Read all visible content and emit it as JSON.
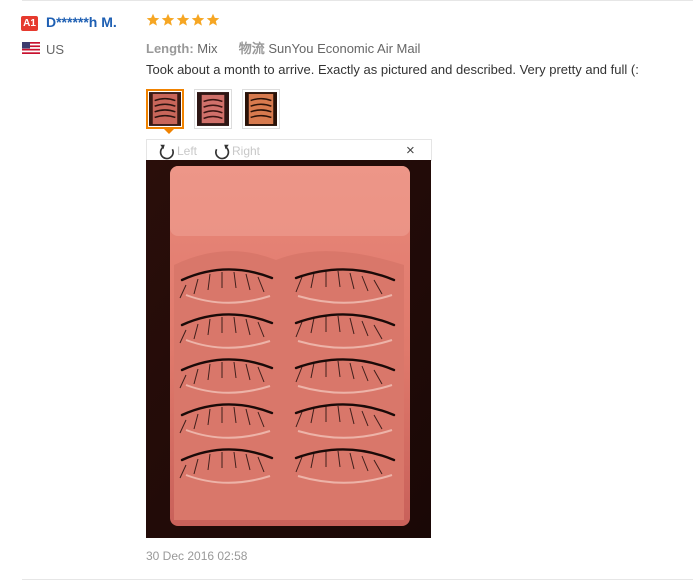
{
  "review": {
    "badge": "A1",
    "user_name": "D******h M.",
    "country": "US",
    "rating": 5,
    "attributes": [
      {
        "key": "Length:",
        "value": "Mix"
      },
      {
        "key": "物流",
        "value": "SunYou Economic Air Mail"
      }
    ],
    "text": "Took about a month to arrive. Exactly as pictured and described. Very pretty and full (:",
    "date": "30 Dec 2016 02:58"
  },
  "viewer": {
    "rotate_left_label": "Left",
    "rotate_right_label": "Right",
    "close_label": "×"
  },
  "colors": {
    "star": "#f6a623",
    "link": "#1e5fb3",
    "badge": "#e63a2e",
    "thumb_active_border": "#f08200"
  },
  "icons": [
    "star-icon",
    "us-flag-icon",
    "rotate-left-icon",
    "rotate-right-icon",
    "close-icon"
  ]
}
